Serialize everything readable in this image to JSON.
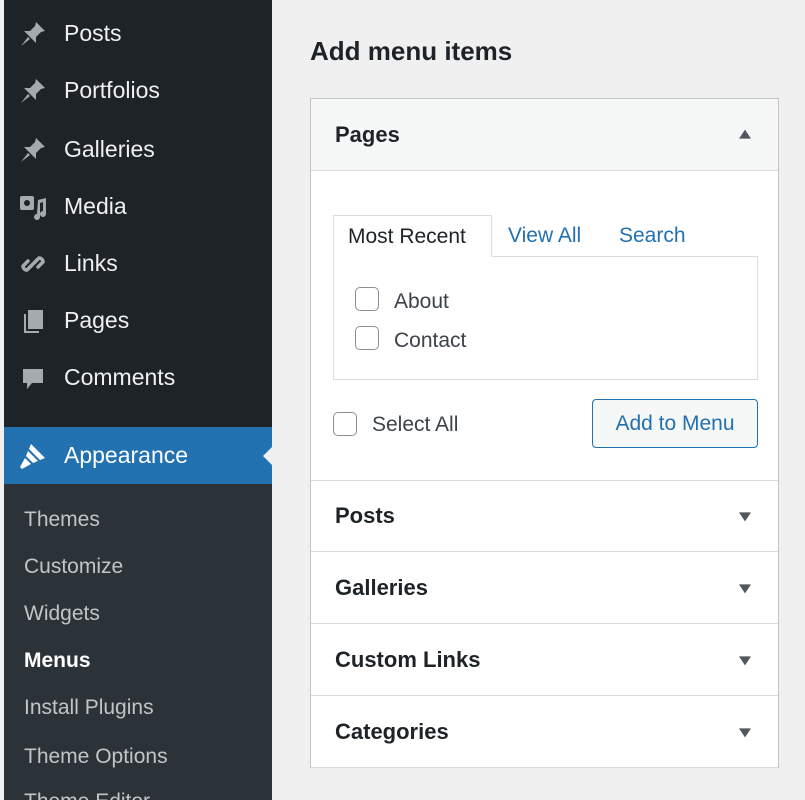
{
  "sidebar": {
    "items": [
      {
        "label": "Posts",
        "icon": "pin-icon"
      },
      {
        "label": "Portfolios",
        "icon": "pin-icon"
      },
      {
        "label": "Galleries",
        "icon": "pin-icon"
      },
      {
        "label": "Media",
        "icon": "media-icon"
      },
      {
        "label": "Links",
        "icon": "link-icon"
      },
      {
        "label": "Pages",
        "icon": "pages-icon"
      },
      {
        "label": "Comments",
        "icon": "comment-icon"
      }
    ],
    "active": {
      "label": "Appearance",
      "icon": "paintbrush-icon"
    },
    "submenu": [
      "Themes",
      "Customize",
      "Widgets",
      "Menus",
      "Install Plugins",
      "Theme Options",
      "Theme Editor"
    ],
    "current_submenu": "Menus"
  },
  "main": {
    "title": "Add menu items",
    "sections": [
      {
        "label": "Pages",
        "expanded": true
      },
      {
        "label": "Posts",
        "expanded": false
      },
      {
        "label": "Galleries",
        "expanded": false
      },
      {
        "label": "Custom Links",
        "expanded": false
      },
      {
        "label": "Categories",
        "expanded": false
      }
    ],
    "tabs": [
      "Most Recent",
      "View All",
      "Search"
    ],
    "items": [
      "About",
      "Contact"
    ],
    "select_all": "Select All",
    "add_button": "Add to Menu"
  },
  "colors": {
    "sidebar_bg": "#1d2327",
    "accent": "#2271b1",
    "submenu_bg": "#2c3338"
  }
}
